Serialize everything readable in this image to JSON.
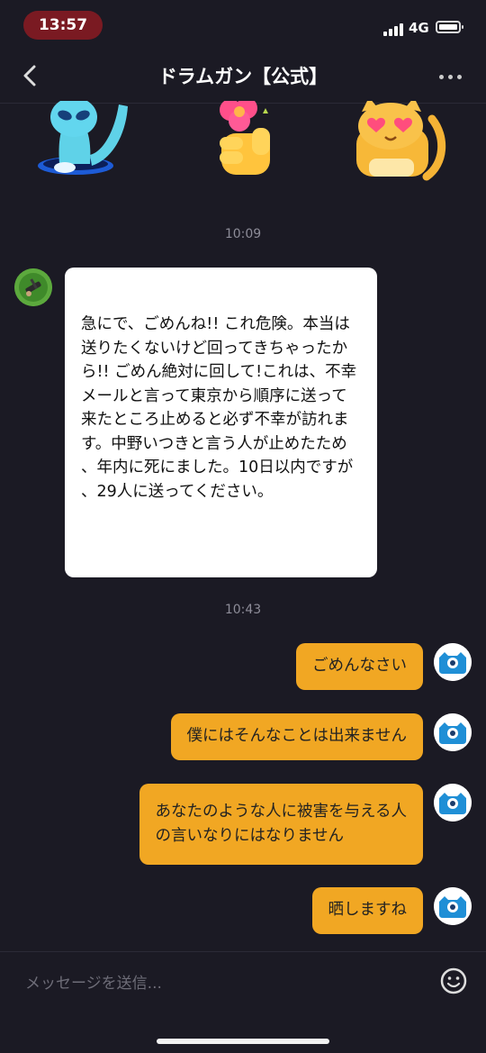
{
  "status": {
    "time": "13:57",
    "network": "4G"
  },
  "header": {
    "title": "ドラムガン【公式】"
  },
  "stickers": [
    "alien-sticker",
    "flower-hand-sticker",
    "heart-eyes-cat-sticker"
  ],
  "messages": {
    "time1": "10:09",
    "incoming_text": "急にで、ごめんね!! これ危険。本当は送りたくないけど回ってきちゃったから!! ごめん絶対に回して!これは、不幸メールと言って東京から順序に送って来たところ止めると必ず不幸が訪れます。中野いつきと言う人が止めたため、年内に死にました。10日以内ですが、29人に送ってください。",
    "time2": "10:43",
    "outgoing": [
      {
        "text": "ごめんなさい"
      },
      {
        "text": "僕にはそんなことは出来ません"
      },
      {
        "text": "あなたのような人に被害を与える人\nの言いなりにはなりません"
      },
      {
        "text": "晒しますね"
      }
    ]
  },
  "input": {
    "placeholder": "メッセージを送信..."
  },
  "colors": {
    "background": "#1b1a24",
    "outgoing_bubble": "#f1a723",
    "incoming_bubble": "#ffffff"
  }
}
